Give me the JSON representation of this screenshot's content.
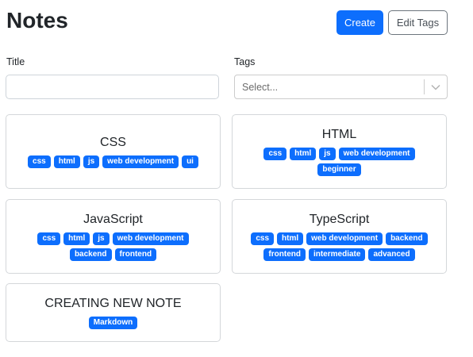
{
  "header": {
    "title": "Notes",
    "create_label": "Create",
    "edit_tags_label": "Edit Tags"
  },
  "form": {
    "title_label": "Title",
    "title_value": "",
    "tags_label": "Tags",
    "tags_placeholder": "Select..."
  },
  "colors": {
    "accent": "#0d6efd",
    "badge_text": "#ffffff"
  },
  "notes": [
    {
      "title": "CSS",
      "tags": [
        "css",
        "html",
        "js",
        "web development",
        "ui"
      ]
    },
    {
      "title": "HTML",
      "tags": [
        "css",
        "html",
        "js",
        "web development",
        "beginner"
      ]
    },
    {
      "title": "JavaScript",
      "tags": [
        "css",
        "html",
        "js",
        "web development",
        "backend",
        "frontend"
      ]
    },
    {
      "title": "TypeScript",
      "tags": [
        "css",
        "html",
        "web development",
        "backend",
        "frontend",
        "intermediate",
        "advanced"
      ]
    },
    {
      "title": "CREATING NEW NOTE",
      "tags": [
        "Markdown"
      ]
    }
  ]
}
